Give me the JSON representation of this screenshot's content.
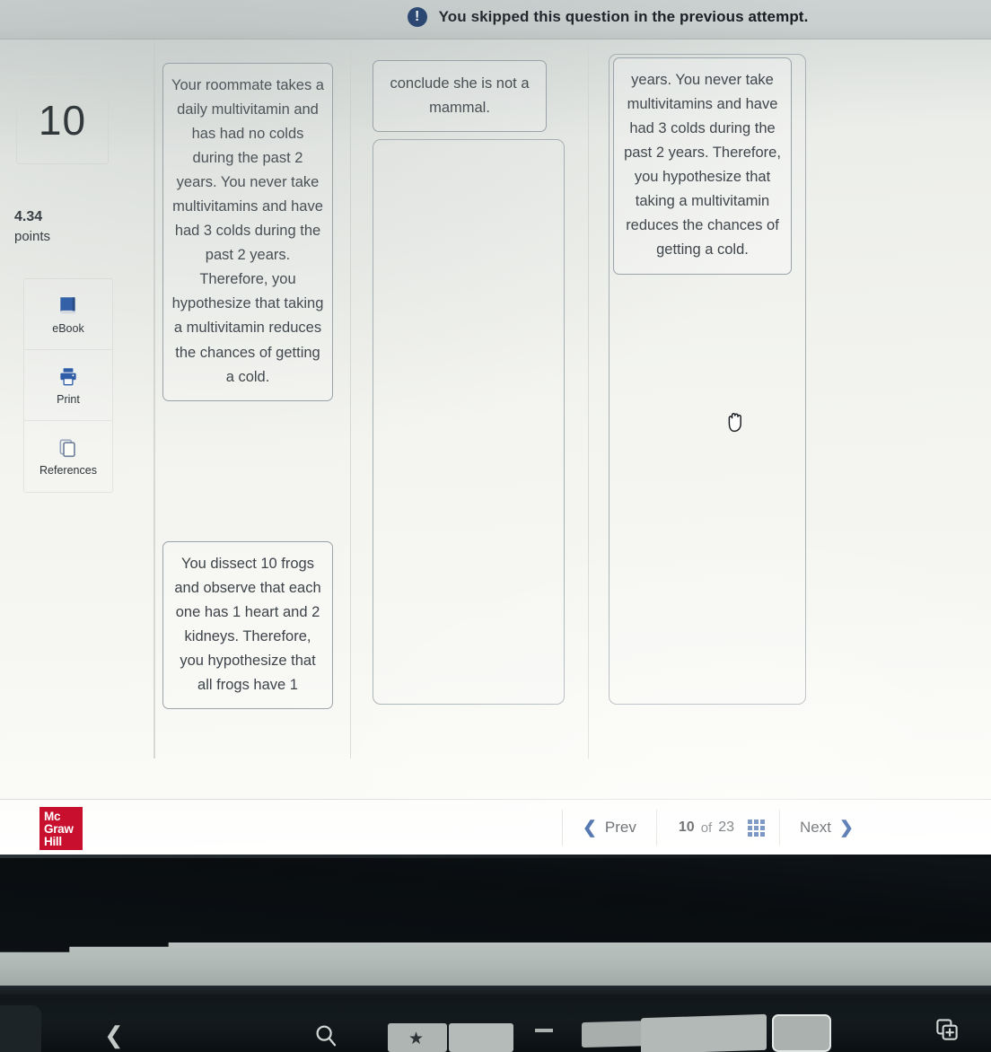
{
  "alert": {
    "icon": "alert-exclamation-icon",
    "text": "You skipped this question in the previous attempt."
  },
  "sidebar": {
    "question_number": "10",
    "points_value": "4.34",
    "points_label": "points",
    "tools": [
      {
        "icon": "ebook-icon",
        "label": "eBook"
      },
      {
        "icon": "printer-icon",
        "label": "Print"
      },
      {
        "icon": "references-copy-icon",
        "label": "References"
      }
    ]
  },
  "question": {
    "source_items": [
      {
        "id": "source-item-multivitamin",
        "text": "Your roommate takes a daily multivitamin and has had no colds during the past 2 years. You never take multivitamins and have had 3 colds during the past 2 years. Therefore, you hypothesize that taking a multivitamin reduces the chances of getting a cold."
      },
      {
        "id": "source-item-frogs",
        "text": "You dissect 10 frogs and observe that each one has 1 heart and 2 kidneys. Therefore, you hypothesize that all frogs have 1"
      }
    ],
    "drop_zone_a": {
      "id": "drop-zone-deductive",
      "placed_item": "conclude she is not a mammal."
    },
    "drop_zone_b": {
      "id": "drop-zone-inductive",
      "placed_item": "years. You never take multivitamins and have had 3 colds during the past 2 years. Therefore, you hypothesize that taking a multivitamin reduces the chances of getting a cold."
    },
    "cursor": "grabbing-hand-cursor"
  },
  "footer": {
    "brand": {
      "line1": "Mc",
      "line2": "Graw",
      "line3": "Hill",
      "color": "#c8102e"
    },
    "prev_label": "Prev",
    "next_label": "Next",
    "pager_current": "10",
    "pager_of": "of",
    "pager_total": "23",
    "grid_icon": "question-grid-icon"
  },
  "device_bar": {
    "back_icon": "back-chevron-icon",
    "search_icon": "search-magnifier-icon",
    "bookmark_icon": "star-bookmark-icon",
    "minus_icon": "minus-icon",
    "new_tab_icon": "new-tab-icon"
  },
  "colors": {
    "accent_blue": "#1e4d9b",
    "alert_navy": "#1b3a6b",
    "brand_red": "#c8102e",
    "screen_bg": "#f2f3ef",
    "text": "#3d4349"
  }
}
